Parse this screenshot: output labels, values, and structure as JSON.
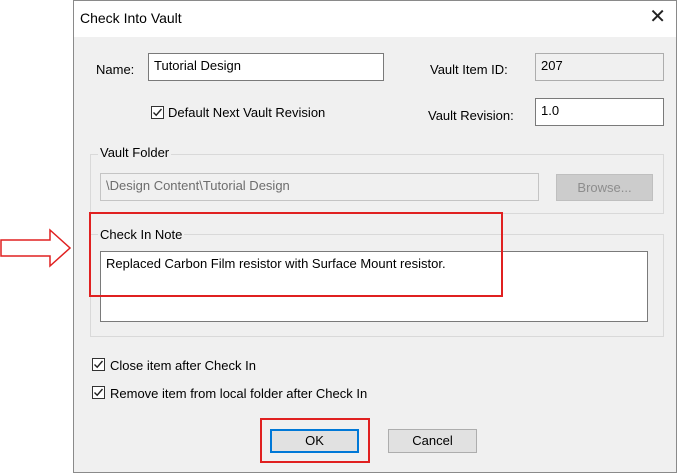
{
  "window": {
    "title": "Check Into Vault",
    "close_glyph": "✕"
  },
  "form": {
    "name_label": "Name:",
    "name_value": "Tutorial Design",
    "vault_item_id_label": "Vault Item ID:",
    "vault_item_id_value": "207",
    "default_next_revision_label": "Default Next Vault Revision",
    "default_next_revision_checked": true,
    "vault_revision_label": "Vault Revision:",
    "vault_revision_value": "1.0"
  },
  "vault_folder": {
    "title": "Vault Folder",
    "path": "\\Design Content\\Tutorial Design",
    "browse_label": "Browse..."
  },
  "check_in_note": {
    "title": "Check In Note",
    "text": "Replaced Carbon Film resistor with Surface Mount resistor."
  },
  "options": {
    "close_after_label": "Close item after Check In",
    "close_after_checked": true,
    "remove_local_label": "Remove item from local folder after Check In",
    "remove_local_checked": true
  },
  "buttons": {
    "ok_label": "OK",
    "cancel_label": "Cancel"
  },
  "annotation": {
    "arrow_icon": "right-arrow-icon",
    "highlight_color": "#e02020"
  }
}
